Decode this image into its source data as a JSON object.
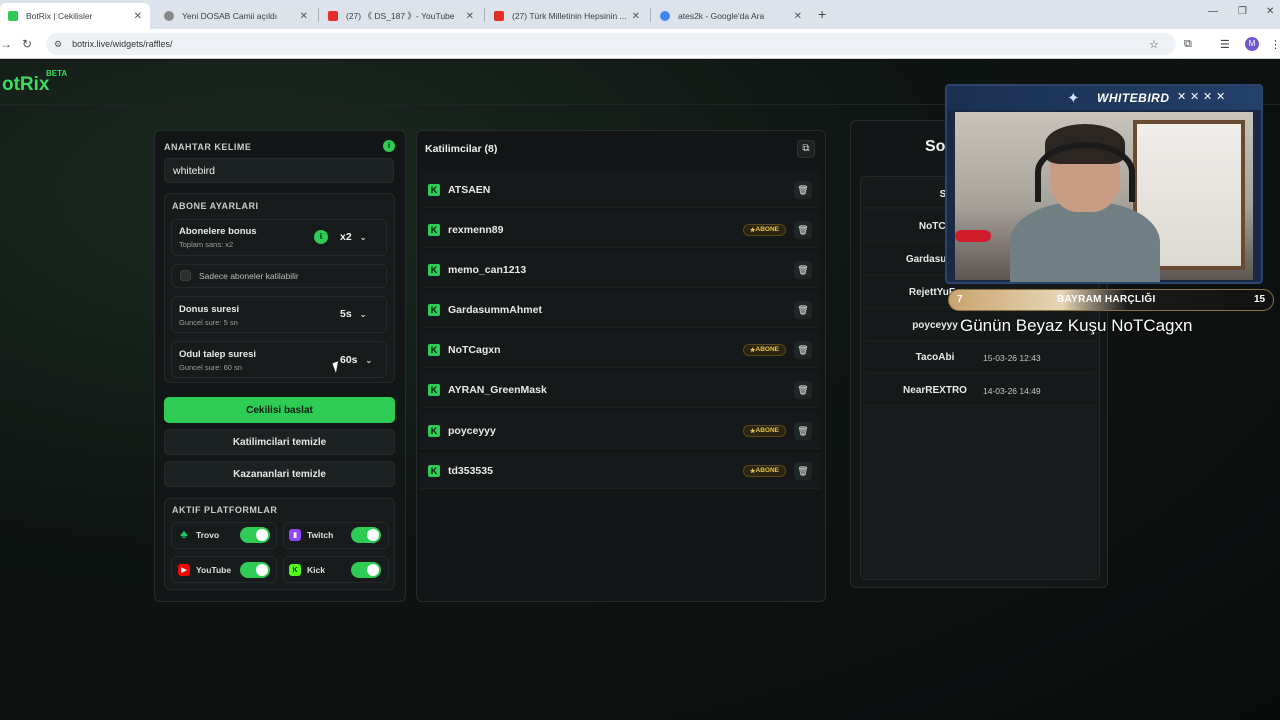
{
  "browser": {
    "tabs": [
      {
        "label": "BotRix | Cekilisler",
        "favicon_color": "#2ecc55"
      },
      {
        "label": "Yeni DOSAB Camii açıldı",
        "favicon_color": "#888888"
      },
      {
        "label": "(27) 《 DS_187 》- YouTube",
        "favicon_color": "#e52d27"
      },
      {
        "label": "(27) Türk Milletinin Hepsinin ...",
        "favicon_color": "#e52d27"
      },
      {
        "label": "ates2k - Google'da Ara",
        "favicon_color": "#4285f4"
      }
    ],
    "url": "botrix.live/widgets/raffles/",
    "account_initial": "M"
  },
  "brand": {
    "name": "otRix",
    "badge": "BETA"
  },
  "settings": {
    "keyword_label": "ANAHTAR KELIME",
    "keyword_value": "whitebird",
    "subscriber_section": "ABONE AYARLARI",
    "bonus_title": "Abonelere bonus",
    "bonus_sub": "Toplam sans: x2",
    "bonus_value": "x2",
    "subs_only_label": "Sadece aboneler katilabilir",
    "spin_title": "Donus suresi",
    "spin_sub": "Guncel sure: 5 sn",
    "spin_value": "5s",
    "claim_title": "Odul talep suresi",
    "claim_sub": "Guncel sure: 60 sn",
    "claim_value": "60s",
    "start_btn": "Cekilisi baslat",
    "clear_participants_btn": "Katilimcilari temizle",
    "clear_winners_btn": "Kazananlari temizle",
    "platforms_section": "AKTIF PLATFORMLAR",
    "platforms": [
      {
        "name": "Trovo",
        "icon": "trovo-icon",
        "color": "#19d66b",
        "enabled": true
      },
      {
        "name": "Twitch",
        "icon": "twitch-icon",
        "color": "#9146ff",
        "enabled": true
      },
      {
        "name": "YouTube",
        "icon": "youtube-icon",
        "color": "#ff0000",
        "enabled": true
      },
      {
        "name": "Kick",
        "icon": "kick-icon",
        "color": "#53fc18",
        "enabled": true
      }
    ]
  },
  "participants": {
    "title": "Katilimcilar (8)",
    "badge_label": "ABONE",
    "items": [
      {
        "name": "ATSAEN",
        "subscriber": false
      },
      {
        "name": "rexmenn89",
        "subscriber": true
      },
      {
        "name": "memo_can1213",
        "subscriber": false
      },
      {
        "name": "GardasummAhmet",
        "subscriber": false
      },
      {
        "name": "NoTCagxn",
        "subscriber": true
      },
      {
        "name": "AYRAN_GreenMask",
        "subscriber": false
      },
      {
        "name": "poyceyyy",
        "subscriber": true
      },
      {
        "name": "td353535",
        "subscriber": true
      }
    ]
  },
  "winners": {
    "title": "So",
    "header_letter": "S",
    "items": [
      {
        "name": "NoTCa",
        "date": ""
      },
      {
        "name": "Gardasumm",
        "date": ""
      },
      {
        "name": "RejettYuFu",
        "date": ""
      },
      {
        "name": "poyceyyy",
        "date": ""
      },
      {
        "name": "TacoAbi",
        "date": "15-03-26 12:43"
      },
      {
        "name": "NearREXTRO",
        "date": "14-03-26 14:49"
      }
    ]
  },
  "webcam": {
    "logo": "WHITEBIRD",
    "close_marks": [
      "✕",
      "✕",
      "✕",
      "✕"
    ],
    "bar_left": "7",
    "bar_title": "BAYRAM HARÇLIĞI",
    "bar_right": "15",
    "caption": "Günün Beyaz Kuşu NoTCagxn"
  }
}
